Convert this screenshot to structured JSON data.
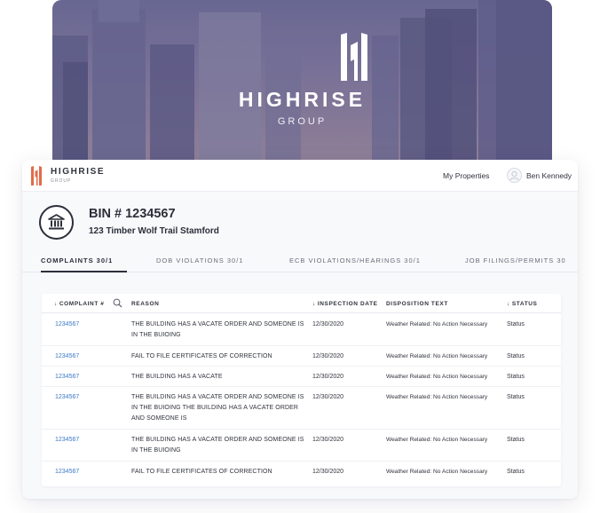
{
  "hero": {
    "brand": "HIGHRISE",
    "subtitle": "GROUP"
  },
  "topbar": {
    "brand": "HIGHRISE",
    "brand_sub": "GROUP",
    "nav_link": "My Properties",
    "user_name": "Ben Kennedy"
  },
  "property": {
    "bin": "BIN # 1234567",
    "address": "123 Timber Wolf Trail Stamford"
  },
  "tabs": [
    {
      "label": "COMPLAINTS 30/1",
      "active": true
    },
    {
      "label": "DOB VIOLATIONS  30/1",
      "active": false
    },
    {
      "label": "ECB VIOLATIONS/HEARINGS  30/1",
      "active": false
    },
    {
      "label": "JOB FILINGS/PERMITS 30",
      "active": false
    }
  ],
  "table": {
    "columns": {
      "complaint": "COMPLAINT #",
      "reason": "REASON",
      "inspection_date": "INSPECTION DATE",
      "disposition": "DISPOSITION TEXT",
      "status": "STATUS"
    },
    "sort_arrow": "↓",
    "rows": [
      {
        "complaint": "1234567",
        "reason": "THE BUILDING HAS A VACATE ORDER AND SOMEONE IS IN THE BUIOING",
        "date": "12/30/2020",
        "disposition": "Weather Related: No Action Necessary",
        "status": "Status"
      },
      {
        "complaint": "1234567",
        "reason": "FAIL TO FILE CERTIFICATES OF CORRECTION",
        "date": "12/30/2020",
        "disposition": "Weather Related: No Action Necessary",
        "status": "Status"
      },
      {
        "complaint": "1234567",
        "reason": "THE BUILDING HAS A VACATE",
        "date": "12/30/2020",
        "disposition": "Weather Related: No Action Necessary",
        "status": "Status"
      },
      {
        "complaint": "1234567",
        "reason": "THE BUILDING HAS A VACATE ORDER AND SOMEONE IS IN THE BUIOING THE BUILDING HAS A VACATE ORDER AND SOMEONE IS",
        "date": "12/30/2020",
        "disposition": "Weather Related: No Action Necessary",
        "status": "Status"
      },
      {
        "complaint": "1234567",
        "reason": "THE BUILDING HAS A VACATE ORDER AND SOMEONE IS IN THE BUIOING",
        "date": "12/30/2020",
        "disposition": "Weather Related: No Action Necessary",
        "status": "Status"
      },
      {
        "complaint": "1234567",
        "reason": "FAIL TO FILE CERTIFICATES OF CORRECTION",
        "date": "12/30/2020",
        "disposition": "Weather Related: No Action Necessary",
        "status": "Status"
      }
    ]
  },
  "colors": {
    "brand_accent": "#e26b4a",
    "link": "#3b78c4",
    "text_dark": "#2b2f3a",
    "hero_tint": "#6e6d95"
  },
  "icons": {
    "hero_logo": "highrise-logo-icon",
    "brand_logo": "highrise-logo-icon",
    "avatar": "user-avatar-icon",
    "bin": "bank-building-icon",
    "search": "search-icon",
    "sort": "arrow-down-icon"
  }
}
